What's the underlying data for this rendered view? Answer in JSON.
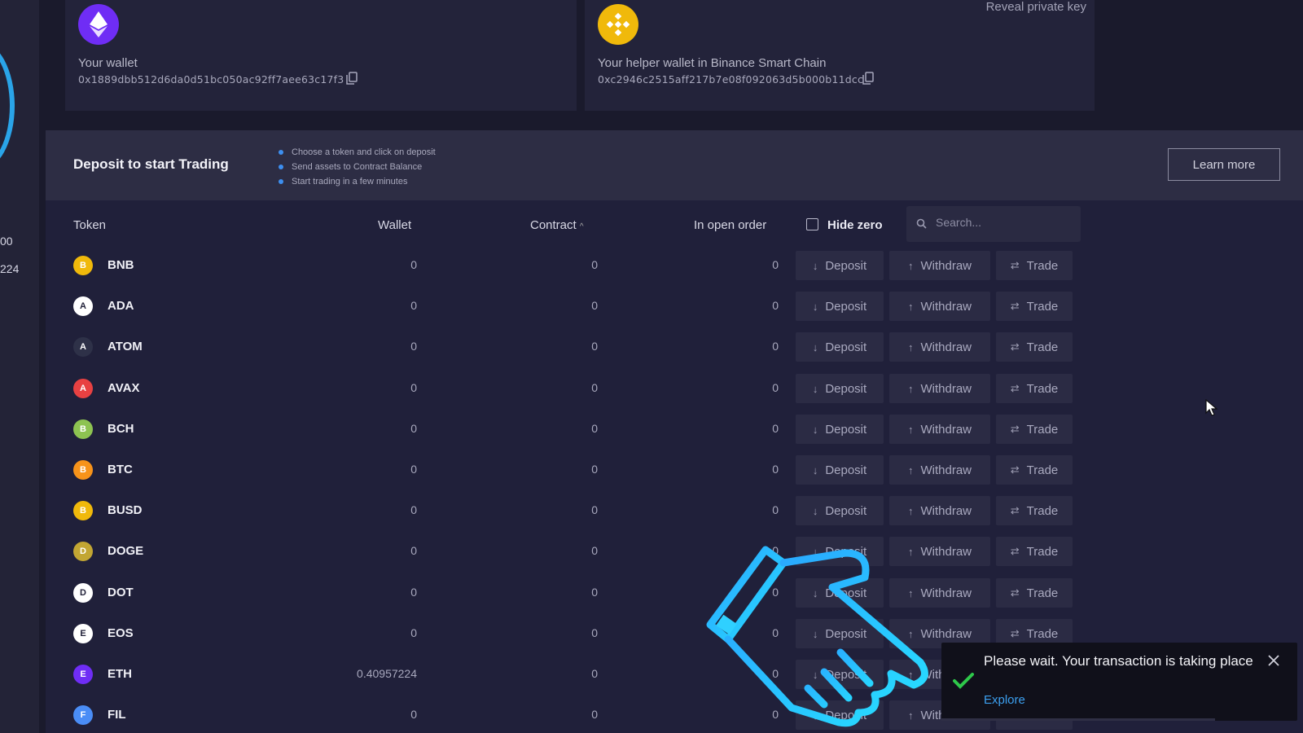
{
  "left_panel": {
    "numbers": [
      "00",
      "224"
    ]
  },
  "wallet": {
    "label": "Your wallet",
    "address": "0x1889dbb512d6da0d51bc050ac92ff7aee63c17f3"
  },
  "helper_wallet": {
    "label": "Your helper wallet in Binance Smart Chain",
    "address": "0xc2946c2515aff217b7e08f092063d5b000b11dcc",
    "reveal_label": "Reveal private key"
  },
  "banner": {
    "title": "Deposit to start Trading",
    "steps": [
      "Choose a token and click on deposit",
      "Send assets to Contract Balance",
      "Start trading in a few minutes"
    ],
    "learn_more": "Learn more"
  },
  "table": {
    "headers": {
      "token": "Token",
      "wallet": "Wallet",
      "contract": "Contract",
      "contract_sort": "^",
      "in_open_order": "In open order"
    },
    "hide_zero_label": "Hide zero",
    "search_placeholder": "Search...",
    "actions": {
      "deposit": "Deposit",
      "withdraw": "Withdraw",
      "trade": "Trade"
    },
    "rows": [
      {
        "symbol": "BNB",
        "wallet": "0",
        "contract": "0",
        "open_order": "0",
        "icon": "bnb-icon",
        "color": "#f0b90b"
      },
      {
        "symbol": "ADA",
        "wallet": "0",
        "contract": "0",
        "open_order": "0",
        "icon": "ada-icon",
        "color": "#ffffff"
      },
      {
        "symbol": "ATOM",
        "wallet": "0",
        "contract": "0",
        "open_order": "0",
        "icon": "atom-icon",
        "color": "#2e3148"
      },
      {
        "symbol": "AVAX",
        "wallet": "0",
        "contract": "0",
        "open_order": "0",
        "icon": "avax-icon",
        "color": "#e84142"
      },
      {
        "symbol": "BCH",
        "wallet": "0",
        "contract": "0",
        "open_order": "0",
        "icon": "bch-icon",
        "color": "#8dc351"
      },
      {
        "symbol": "BTC",
        "wallet": "0",
        "contract": "0",
        "open_order": "0",
        "icon": "btc-icon",
        "color": "#f7931a"
      },
      {
        "symbol": "BUSD",
        "wallet": "0",
        "contract": "0",
        "open_order": "0",
        "icon": "busd-icon",
        "color": "#f0b90b"
      },
      {
        "symbol": "DOGE",
        "wallet": "0",
        "contract": "0",
        "open_order": "0",
        "icon": "doge-icon",
        "color": "#c2a633"
      },
      {
        "symbol": "DOT",
        "wallet": "0",
        "contract": "0",
        "open_order": "0",
        "icon": "dot-icon",
        "color": "#ffffff"
      },
      {
        "symbol": "EOS",
        "wallet": "0",
        "contract": "0",
        "open_order": "0",
        "icon": "eos-icon",
        "color": "#ffffff"
      },
      {
        "symbol": "ETH",
        "wallet": "0.40957224",
        "contract": "0",
        "open_order": "0",
        "icon": "eth-icon",
        "color": "#6f2df5"
      },
      {
        "symbol": "FIL",
        "wallet": "0",
        "contract": "0",
        "open_order": "0",
        "icon": "fil-icon",
        "color": "#4a8df6"
      }
    ]
  },
  "toast": {
    "message": "Please wait. Your transaction is taking place",
    "link": "Explore",
    "progress": 0.77
  },
  "colors": {
    "background": "#1a1a2c",
    "panel": "#20203a",
    "accent": "#3ca0f0",
    "success": "#2ec84a"
  }
}
